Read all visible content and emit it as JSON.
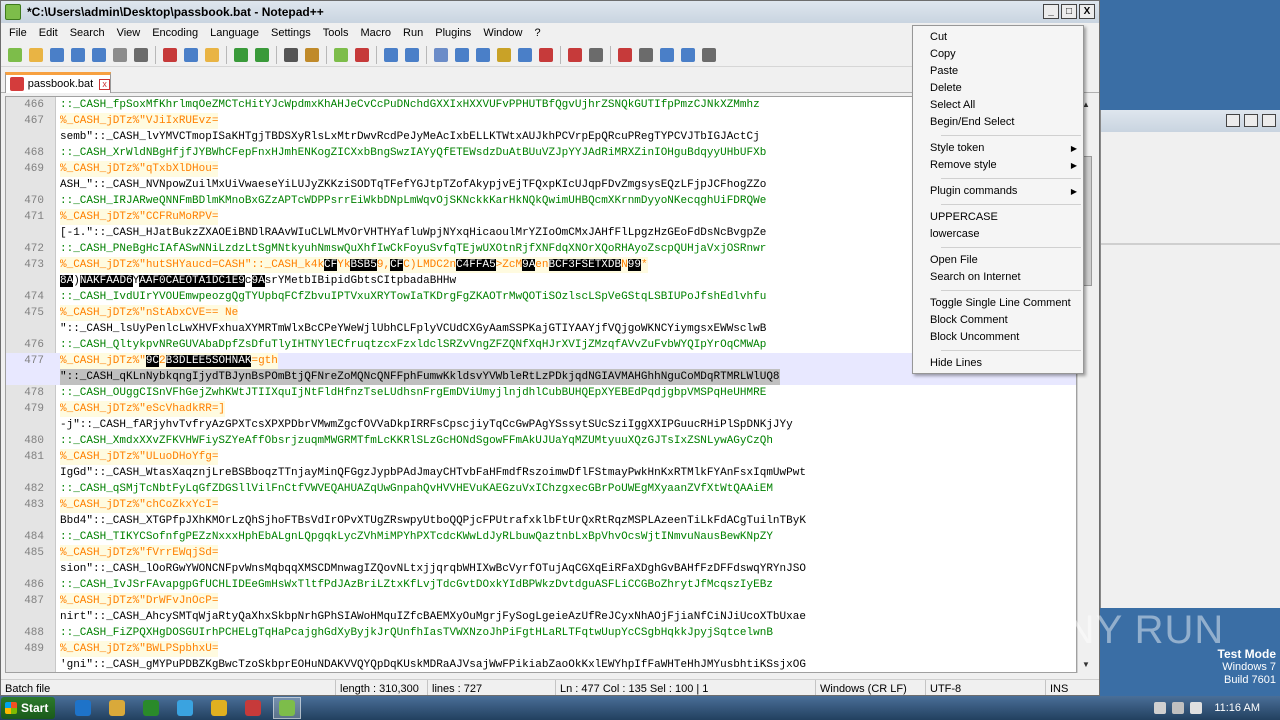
{
  "window": {
    "title": "*C:\\Users\\admin\\Desktop\\passbook.bat - Notepad++",
    "minimize": "_",
    "maximize": "□",
    "close": "X"
  },
  "menu": [
    "File",
    "Edit",
    "Search",
    "View",
    "Encoding",
    "Language",
    "Settings",
    "Tools",
    "Macro",
    "Run",
    "Plugins",
    "Window",
    "?"
  ],
  "toolbar_colors": [
    "#7dbd4a",
    "#e9b444",
    "#4a7fc8",
    "#4a7fc8",
    "#4a7fc8",
    "#8c8c8c",
    "#6b6b6b",
    "#c63a3a",
    "#4a7fc8",
    "#e9b444",
    "#3a9a3a",
    "#3a9a3a",
    "#555555",
    "#c08a2a",
    "#7dbd4a",
    "#c63a3a",
    "#4a7fc8",
    "#4a7fc8",
    "#6b8cc8",
    "#4a7fc8",
    "#4a7fc8",
    "#c9a227",
    "#4a7fc8",
    "#c63a3a",
    "#c63a3a",
    "#6b6b6b",
    "#c63a3a",
    "#6b6b6b",
    "#4a7fc8",
    "#4a7fc8",
    "#6b6b6b"
  ],
  "tab": {
    "label": "passbook.bat",
    "close": "x"
  },
  "editor": {
    "lines": [
      {
        "n": "466",
        "t": "::_CASH_fpSoxMfKhrlmqOeZMCTcHitYJcWpdmxKhAHJeCvCcPuDNchdGXXIxHXXVUFvPPHUTBfQgvUjhrZSNQkGUTIfpPmzCJNkXZMmhz",
        "k": "cmt"
      },
      {
        "n": "467",
        "t": "%_CASH_jDTz%\"VJiIxRUEvz=",
        "k": "lbl"
      },
      {
        "n": "",
        "t": "semb\"::_CASH_lvYMVCTmopISaKHTgjTBDSXyRlsLxMtrDwvRcdPeJyMeAcIxbELLKTWtxAUJkhPCVrpEpQRcuPRegTYPCVJTbIGJActCj",
        "k": "str"
      },
      {
        "n": "468",
        "t": "::_CASH_XrWldNBgHfjfJYBWhCFepFnxHJmhENKogZICXxbBngSwzIAYyQfETEWsdzDuAtBUuVZJpYYJAdRiMRXZinIOHguBdqyyUHbUFXb",
        "k": "cmt"
      },
      {
        "n": "469",
        "t": "%_CASH_jDTz%\"qTxbXlDHou=",
        "k": "lbl"
      },
      {
        "n": "",
        "t": "ASH_\"::_CASH_NVNpowZuilMxUiVwaeseYiLUJyZKKziSODTqTFefYGJtpTZofAkypjvEjTFQxpKIcUJqpFDvZmgsysEQzLFjpJCFhogZZo",
        "k": "str"
      },
      {
        "n": "470",
        "t": "::_CASH_IRJARweQNNFmBDlmKMnoBxGZzAPTcWDPPsrrEiWkbDNpLmWqvOjSKNckkKarHkNQkQwimUHBQcmXKrnmDyyoNKecqghUiFDRQWe",
        "k": "cmt"
      },
      {
        "n": "471",
        "t": "%_CASH_jDTz%\"CCFRuMoRPV=",
        "k": "lbl"
      },
      {
        "n": "",
        "t": "[-1.\"::_CASH_HJatBukzZXAOEiBNDlRAAvWIuCLWLMvOrVHTHYafluWpjNYxqHicaoulMrYZIoOmCMxJAHfFlLpgzHzGEoFdDsNcBvgpZe",
        "k": "str"
      },
      {
        "n": "472",
        "t": "::_CASH_PNeBgHcIAfASwNNiLzdzLtSgMNtkyuhNmswQuXhfIwCkFoyuSvfqTEjwUXOtnRjfXNFdqXNOrXQoRHAyoZscpQUHjaVxjOSRnwr",
        "k": "cmt"
      },
      {
        "n": "473",
        "t": "%_CASH_jDTz%\"hutSHYaucd=CASH\"::_CASH_k4k[CF]Yk[BS][B5]9,[CF]C)LMDC2n[C4][FF][A5]>ZcM[9A]en[BC][F3][FS][ETX][DB]N[99]*",
        "k": "lbl"
      },
      {
        "n": "",
        "t": "[8A])[NAK][F][AA][D6]Y[AA][F0][CA][EOT][A1][DC1][E9]c[9A]srYMetbIBipidGbtsCItpbadaBHHw",
        "k": "str"
      },
      {
        "n": "474",
        "t": "::_CASH_IvdUIrYVOUEmwpeozgQgTYUpbqFCfZbvuIPTVxuXRYTowIaTKDrgFgZKAOTrMwQOTiSOzlscLSpVeGStqLSBIUPoJfshEdlvhfu",
        "k": "cmt"
      },
      {
        "n": "475",
        "t": "%_CASH_jDTz%\"nStAbxCVE== Ne",
        "k": "lbl"
      },
      {
        "n": "",
        "t": "\"::_CASH_lsUyPenlcLwXHVFxhuaXYMRTmWlxBcCPeYWeWjlUbhCLFplyVCUdCXGyAamSSPKajGTIYAAYjfVQjgoWKNCYiymgsxEWWsclwB",
        "k": "str"
      },
      {
        "n": "476",
        "t": "::_CASH_QltykpvNReGUVAbaDpfZsDfuTlyIHTNYlECfruqtzcxFzxldclSRZvVngZFZQNfXqHJrXVIjZMzqfAVvZuFvbWYQIpYrOqCMWAp",
        "k": "cmt"
      },
      {
        "n": "477",
        "t": "%_CASH_jDTz%\"[9C]2[B3][DLE][E5][SOH][NAK]=gth",
        "k": "lbl"
      },
      {
        "n": "",
        "t": "\"::_CASH_qKLnNybkqngIjydTBJynBsPOmBtjQFNreZoMQNcQNFFphFumwKkldsvYVWbleRtLzPDkjqdNGIAVMAHGhhNguCoMDqRTMRLWlUQ8",
        "k": "sel"
      },
      {
        "n": "478",
        "t": "::_CASH_OUggCISnVFhGejZwhKWtJTIIXquIjNtFldHfnzTseLUdhsnFrgEmDViUmyjlnjdhlCubBUHQEpXYEBEdPqdjgbpVMSPqHeUHMRE",
        "k": "cmt"
      },
      {
        "n": "479",
        "t": "%_CASH_jDTz%\"eScVhadkRR=]",
        "k": "lbl"
      },
      {
        "n": "",
        "t": "-j\"::_CASH_fARjyhvTvfryAzGPXTcsXPXPDbrVMwmZgcfOVVaDkpIRRFsCpscjiyTqCcGwPAgYSssytSUcSziIggXXIPGuucRHiPlSpDNKjJYy",
        "k": "str"
      },
      {
        "n": "480",
        "t": "::_CASH_XmdxXXvZFKVHWFiySZYeAffObsrjzuqmMWGRMTfmLcKKRlSLzGcHONdSgowFFmAkUJUaYqMZUMtyuuXQzGJTsIxZSNLywAGyCzQh",
        "k": "cmt"
      },
      {
        "n": "481",
        "t": "%_CASH_jDTz%\"ULuoDHoYfg=",
        "k": "lbl"
      },
      {
        "n": "",
        "t": "IgGd\"::_CASH_WtasXaqznjLreBSBboqzTTnjayMinQFGgzJypbPAdJmayCHTvbFaHFmdfRszoimwDflFStmayPwkHnKxRTMlkFYAnFsxIqmUwPwt",
        "k": "str"
      },
      {
        "n": "482",
        "t": "::_CASH_qSMjTcNbtFyLqGfZDGSllVilFnCtfVWVEQAHUAZqUwGnpahQvHVVHEVuKAEGzuVxIChzgxecGBrPoUWEgMXyaanZVfXtWtQAAiEM",
        "k": "cmt"
      },
      {
        "n": "483",
        "t": "%_CASH_jDTz%\"chCoZkxYcI=",
        "k": "lbl"
      },
      {
        "n": "",
        "t": "Bbd4\"::_CASH_XTGPfpJXhKMOrLzQhSjhoFTBsVdIrOPvXTUgZRswpyUtboQQPjcFPUtrafxklbFtUrQxRtRqzMSPLAzeenTiLkFdACgTuilnTByK",
        "k": "str"
      },
      {
        "n": "484",
        "t": "::_CASH_TIKYCSofnfgPEZzNxxxHphEbALgnLQpgqkLycZVhMiMPYhPXTcdcKWwLdJyRLbuwQaztnbLxBpVhvOcsWjtINmvuNausBewKNpZY",
        "k": "cmt"
      },
      {
        "n": "485",
        "t": "%_CASH_jDTz%\"fVrrEWqjSd=",
        "k": "lbl"
      },
      {
        "n": "",
        "t": "sion\"::_CASH_lOoRGwYWONCNFpvWnsMqbqqXMSCDMnwagIZQovNLtxjjqrqbWHIXwBcVyrfOTujAqCGXqEiRFaXDghGvBAHfFzDFFdswqYRYnJSO",
        "k": "str"
      },
      {
        "n": "486",
        "t": "::_CASH_IvJSrFAvapgpGfUCHLIDEeGmHsWxTltfPdJAzBriLZtxKfLvjTdcGvtDOxkYIdBPWkzDvtdguASFLiCCGBoZhrytJfMcqszIyEBz",
        "k": "cmt"
      },
      {
        "n": "487",
        "t": "%_CASH_jDTz%\"DrWFvJnOcP=",
        "k": "lbl"
      },
      {
        "n": "",
        "t": "nirt\"::_CASH_AhcySMTqWjaRtyQaXhxSkbpNrhGPhSIAWoHMquIZfcBAEMXyOuMgrjFySogLgeieAzUfReJCyxNhAOjFjiaNfCiNJiUcoXTbUxae",
        "k": "str"
      },
      {
        "n": "488",
        "t": "::_CASH_FiZPQXHgDOSGUIrhPCHELgTqHaPcajghGdXyByjkJrQUnfhIasTVWXNzoJhPiFgtHLaRLTFqtwUupYcCSgbHqkkJpyjSqtcelwnB",
        "k": "cmt"
      },
      {
        "n": "489",
        "t": "%_CASH_jDTz%\"BWLPSpbhxU=",
        "k": "lbl"
      },
      {
        "n": "",
        "t": "'gni\"::_CASH_gMYPuPDBZKgBwcTzoSkbprEOHuNDAKVVQYQpDqKUskMDRaAJVsajWwFPikiabZaoOkKxlEWYhpIfFaWHTeHhJMYusbhtiKSsjxOG",
        "k": "str"
      }
    ]
  },
  "context_menu": [
    {
      "label": "Cut"
    },
    {
      "label": "Copy"
    },
    {
      "label": "Paste"
    },
    {
      "label": "Delete"
    },
    {
      "label": "Select All"
    },
    {
      "label": "Begin/End Select"
    },
    {
      "sep": true
    },
    {
      "label": "Style token",
      "sub": "▶"
    },
    {
      "label": "Remove style",
      "sub": "▶"
    },
    {
      "sep": true
    },
    {
      "label": "Plugin commands",
      "sub": "▶"
    },
    {
      "sep": true
    },
    {
      "label": "UPPERCASE"
    },
    {
      "label": "lowercase"
    },
    {
      "sep": true
    },
    {
      "label": "Open File"
    },
    {
      "label": "Search on Internet"
    },
    {
      "sep": true
    },
    {
      "label": "Toggle Single Line Comment"
    },
    {
      "label": "Block Comment"
    },
    {
      "label": "Block Uncomment"
    },
    {
      "sep": true
    },
    {
      "label": "Hide Lines"
    }
  ],
  "status": {
    "type": "Batch file",
    "length": "length : 310,300",
    "lines": "lines : 727",
    "pos": "Ln : 477    Col : 135    Sel : 100 | 1",
    "eol": "Windows (CR LF)",
    "encoding": "UTF-8",
    "mode": "INS"
  },
  "watermark": "ANY RUN",
  "wininfo": {
    "l1": "Test Mode",
    "l2": "Windows 7",
    "l3": "Build 7601"
  },
  "taskbar": {
    "start": "Start",
    "apps": [
      "#1e73c9",
      "#d9a93a",
      "#2a8a2a",
      "#3aa3e0",
      "#e0b020",
      "#c63a3a",
      "#7dbd4a"
    ],
    "clock": "11:16 AM"
  }
}
